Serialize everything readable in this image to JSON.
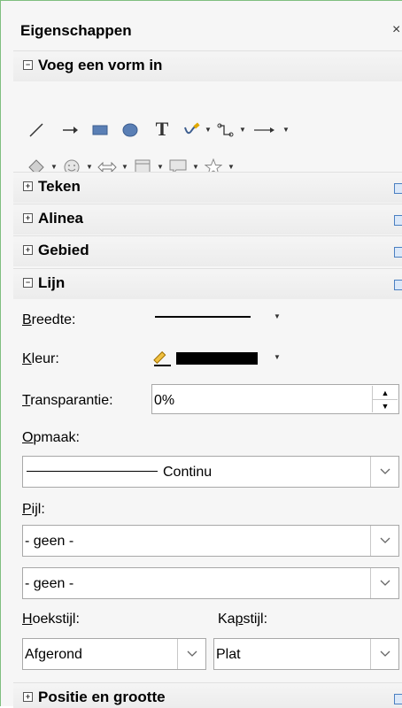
{
  "panel": {
    "title": "Eigenschappen",
    "close": "×"
  },
  "shapes": {
    "header": "Voeg een vorm in",
    "row1": [
      "line-icon",
      "arrow-line-icon",
      "rectangle-icon",
      "ellipse-icon",
      "text-icon",
      "freehand-icon",
      "connector-icon",
      "lines-arrows-icon"
    ],
    "row2": [
      "basic-shapes-icon",
      "symbol-shapes-icon",
      "block-arrows-icon",
      "flowchart-icon",
      "callouts-icon",
      "stars-icon"
    ]
  },
  "sections": {
    "teken": "Teken",
    "alinea": "Alinea",
    "gebied": "Gebied",
    "lijn": "Lijn",
    "positie": "Positie en grootte"
  },
  "line": {
    "breedte_label": "Breedte:",
    "kleur_label": "Kleur:",
    "kleur_value": "#000000",
    "transparantie_label": "Transparantie:",
    "transparantie_value": "0%",
    "opmaak_label": "Opmaak:",
    "opmaak_value": "Continu",
    "pijl_label": "Pijl:",
    "pijl_start": "- geen -",
    "pijl_end": "- geen -",
    "hoekstijl_label": "Hoekstijl:",
    "hoekstijl_value": "Afgerond",
    "kapstijl_label": "Kapstijl:",
    "kapstijl_value": "Plat"
  }
}
